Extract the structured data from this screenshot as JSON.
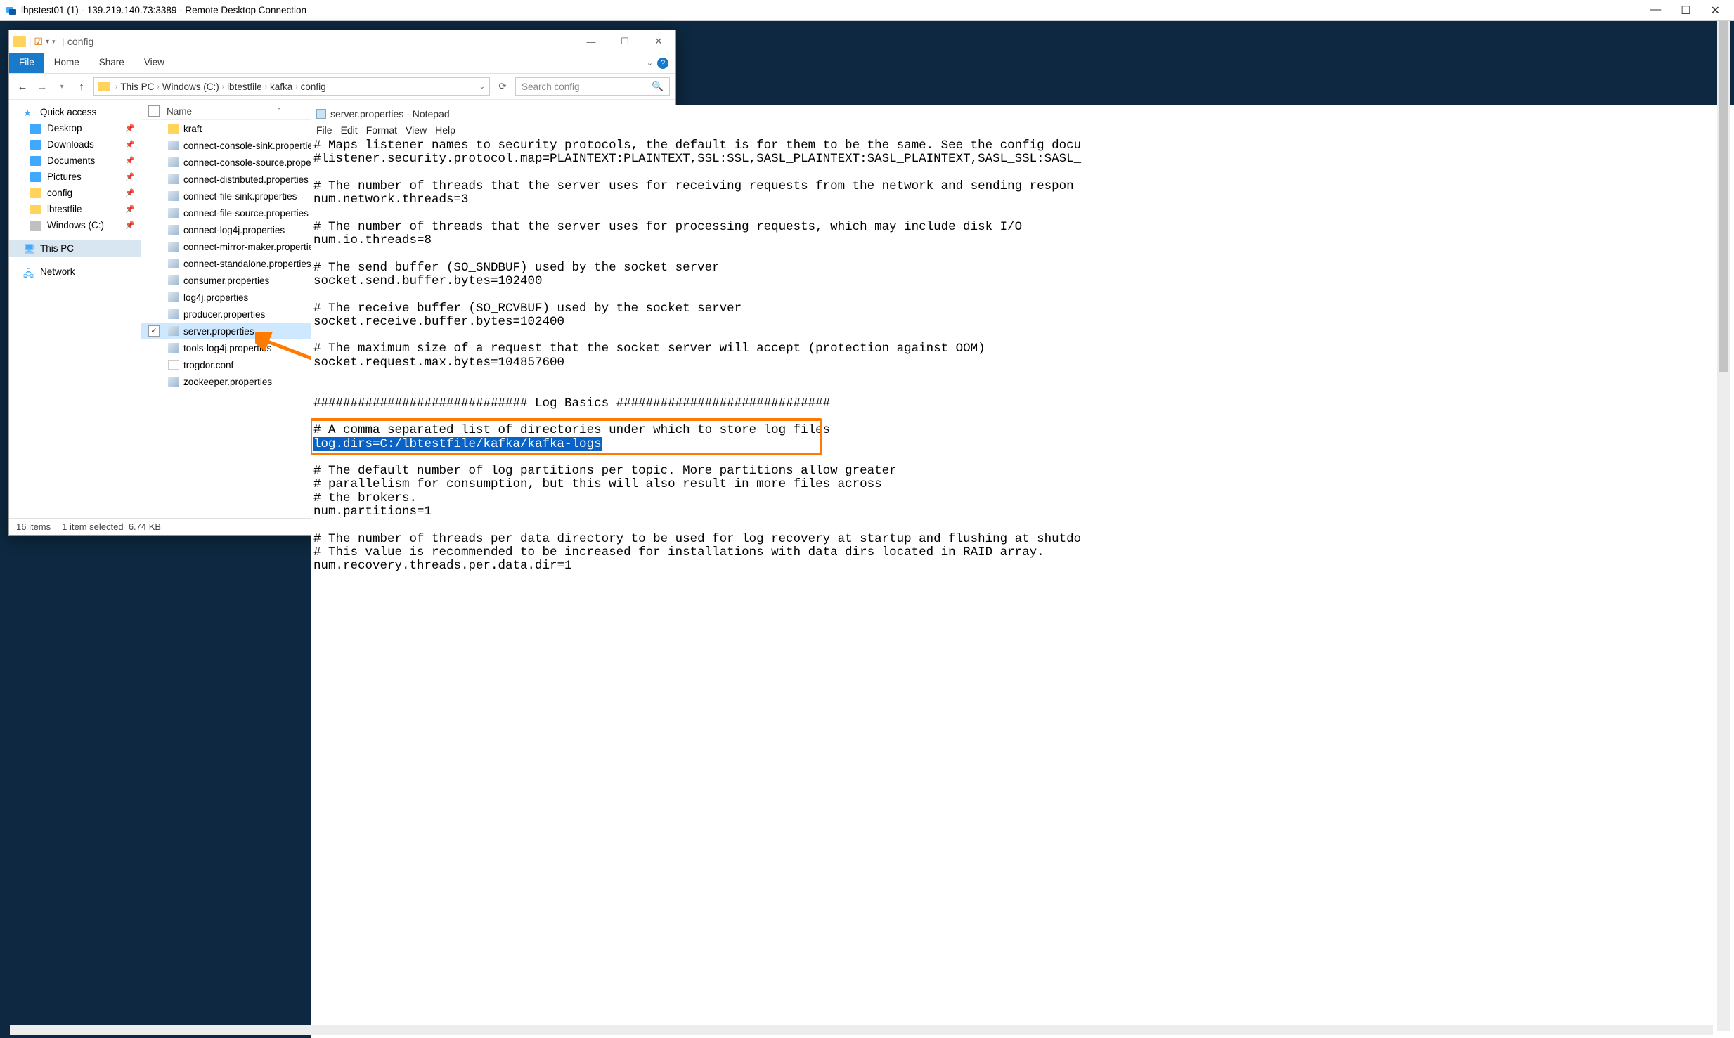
{
  "rdp": {
    "title": "lbpstest01 (1) - 139.219.140.73:3389 - Remote Desktop Connection"
  },
  "explorer": {
    "title": "config",
    "tabs": {
      "file": "File",
      "home": "Home",
      "share": "Share",
      "view": "View"
    },
    "breadcrumb": [
      "This PC",
      "Windows (C:)",
      "lbtestfile",
      "kafka",
      "config"
    ],
    "search_placeholder": "Search config",
    "nav": {
      "quick_access": "Quick access",
      "desktop": "Desktop",
      "downloads": "Downloads",
      "documents": "Documents",
      "pictures": "Pictures",
      "config": "config",
      "lbtestfile": "lbtestfile",
      "windowsC": "Windows (C:)",
      "this_pc": "This PC",
      "network": "Network"
    },
    "col_name": "Name",
    "files": [
      {
        "name": "kraft",
        "type": "folder"
      },
      {
        "name": "connect-console-sink.properties",
        "type": "prop"
      },
      {
        "name": "connect-console-source.properties",
        "type": "prop"
      },
      {
        "name": "connect-distributed.properties",
        "type": "prop"
      },
      {
        "name": "connect-file-sink.properties",
        "type": "prop"
      },
      {
        "name": "connect-file-source.properties",
        "type": "prop"
      },
      {
        "name": "connect-log4j.properties",
        "type": "prop"
      },
      {
        "name": "connect-mirror-maker.properties",
        "type": "prop"
      },
      {
        "name": "connect-standalone.properties",
        "type": "prop"
      },
      {
        "name": "consumer.properties",
        "type": "prop"
      },
      {
        "name": "log4j.properties",
        "type": "prop"
      },
      {
        "name": "producer.properties",
        "type": "prop"
      },
      {
        "name": "server.properties",
        "type": "prop",
        "selected": true
      },
      {
        "name": "tools-log4j.properties",
        "type": "prop"
      },
      {
        "name": "trogdor.conf",
        "type": "txt"
      },
      {
        "name": "zookeeper.properties",
        "type": "prop"
      }
    ],
    "status": {
      "items": "16 items",
      "selected": "1 item selected",
      "size": "6.74 KB"
    }
  },
  "notepad": {
    "title": "server.properties - Notepad",
    "menu": [
      "File",
      "Edit",
      "Format",
      "View",
      "Help"
    ],
    "lines": [
      "# Maps listener names to security protocols, the default is for them to be the same. See the config docu",
      "#listener.security.protocol.map=PLAINTEXT:PLAINTEXT,SSL:SSL,SASL_PLAINTEXT:SASL_PLAINTEXT,SASL_SSL:SASL_",
      "",
      "# The number of threads that the server uses for receiving requests from the network and sending respon",
      "num.network.threads=3",
      "",
      "# The number of threads that the server uses for processing requests, which may include disk I/O",
      "num.io.threads=8",
      "",
      "# The send buffer (SO_SNDBUF) used by the socket server",
      "socket.send.buffer.bytes=102400",
      "",
      "# The receive buffer (SO_RCVBUF) used by the socket server",
      "socket.receive.buffer.bytes=102400",
      "",
      "# The maximum size of a request that the socket server will accept (protection against OOM)",
      "socket.request.max.bytes=104857600",
      "",
      "",
      "############################# Log Basics #############################",
      "",
      "# A comma separated list of directories under which to store log files",
      "log.dirs=C:/lbtestfile/kafka/kafka-logs",
      "",
      "# The default number of log partitions per topic. More partitions allow greater",
      "# parallelism for consumption, but this will also result in more files across",
      "# the brokers.",
      "num.partitions=1",
      "",
      "# The number of threads per data directory to be used for log recovery at startup and flushing at shutdo",
      "# This value is recommended to be increased for installations with data dirs located in RAID array.",
      "num.recovery.threads.per.data.dir=1"
    ],
    "highlight_line_index": 22
  }
}
